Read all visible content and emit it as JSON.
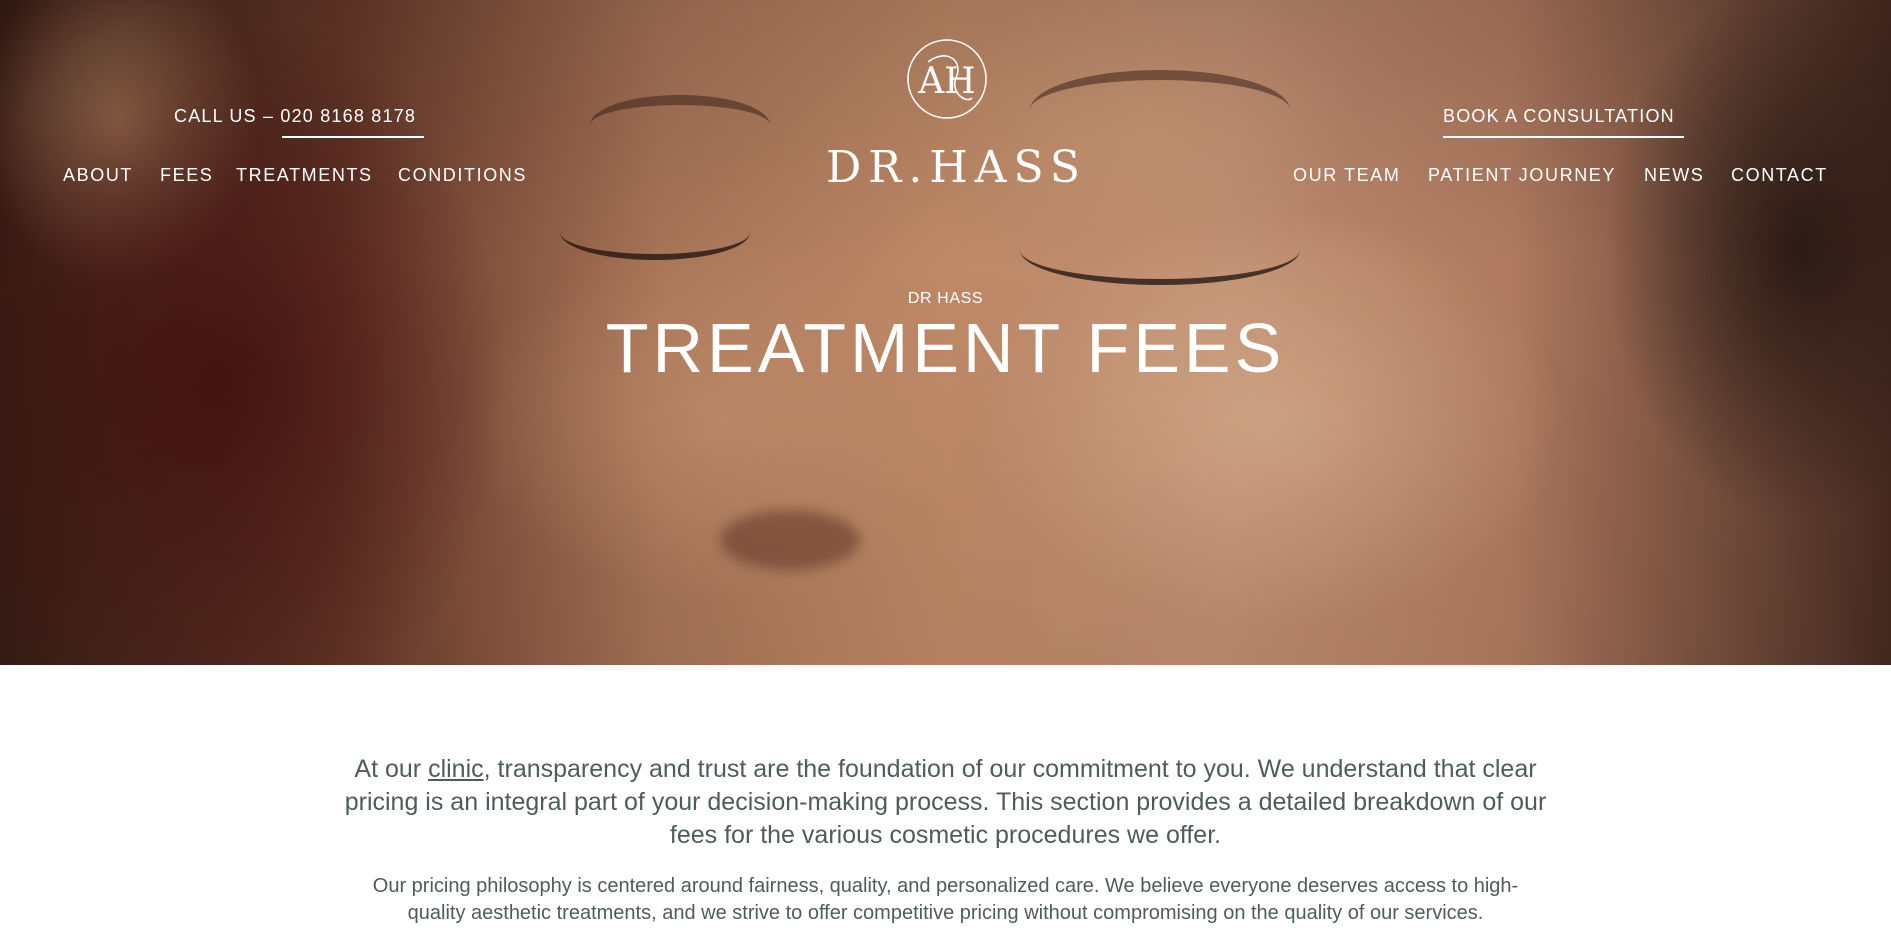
{
  "header": {
    "call_us": "CALL US – 020 8168 8178",
    "book_consultation": "BOOK A CONSULTATION",
    "logo_text": "DR.HASS",
    "logo_monogram": "AH",
    "nav_left": [
      "ABOUT",
      "FEES",
      "TREATMENTS",
      "CONDITIONS"
    ],
    "nav_right": [
      "OUR TEAM",
      "PATIENT JOURNEY",
      "NEWS",
      "CONTACT"
    ]
  },
  "hero": {
    "eyebrow": "DR HASS",
    "title": "TREATMENT FEES"
  },
  "intro": {
    "lead_prefix": "At our ",
    "lead_link": "clinic",
    "lead_suffix": ", transparency and trust are the foundation of our commitment to you. We understand that clear pricing is an integral part of your decision-making process. This section provides a detailed breakdown of our fees for the various cosmetic procedures we offer.",
    "body": "Our pricing philosophy is centered around fairness, quality, and personalized care. We believe everyone deserves access to high-quality aesthetic treatments, and we strive to offer competitive pricing without compromising on the quality of our services."
  },
  "colors": {
    "text": "#4f5d58",
    "nav_text": "#ffffff",
    "background": "#ffffff"
  }
}
